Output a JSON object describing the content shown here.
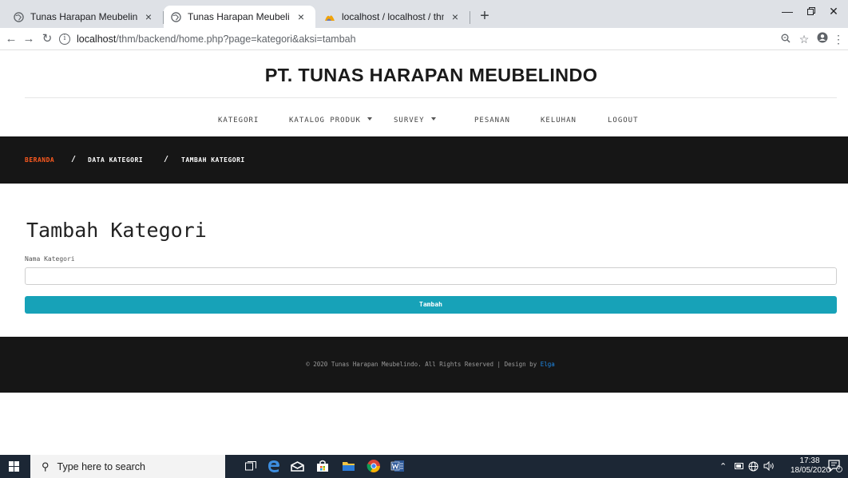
{
  "browser": {
    "tabs": [
      {
        "title": "Tunas Harapan Meubelindo",
        "active": false
      },
      {
        "title": "Tunas Harapan Meubelindo",
        "active": true
      },
      {
        "title": "localhost / localhost / thm / surv",
        "active": false
      }
    ],
    "tab_close_glyph": "×",
    "new_tab_glyph": "+",
    "url_host": "localhost",
    "url_path": "/thm/backend/home.php?page=kategori&aksi=tambah"
  },
  "site": {
    "title": "PT. TUNAS HARAPAN MEUBELINDO",
    "menu": [
      {
        "label": "KATEGORI",
        "dropdown": false
      },
      {
        "label": "KATALOG PRODUK",
        "dropdown": true
      },
      {
        "label": "SURVEY",
        "dropdown": true
      },
      {
        "label": "PESANAN",
        "dropdown": false
      },
      {
        "label": "KELUHAN",
        "dropdown": false
      },
      {
        "label": "LOGOUT",
        "dropdown": false
      }
    ],
    "breadcrumb": {
      "home": "BERANDA",
      "separator": "/",
      "level1": "DATA KATEGORI",
      "level2": "TAMBAH KATEGORI"
    },
    "colors": {
      "accent_breadcrumb": "#ff5a1f",
      "button": "#17a2b8",
      "dark_band": "#161616",
      "footer_link": "#1e88e5"
    }
  },
  "form": {
    "heading": "Tambah Kategori",
    "label": "Nama Kategori",
    "value": "",
    "submit_label": "Tambah"
  },
  "footer": {
    "text": "© 2020 Tunas Harapan Meubelindo. All Rights Reserved | Design by ",
    "author": "Elga"
  },
  "taskbar": {
    "search_placeholder": "Type here to search",
    "time": "17:38",
    "date": "18/05/2020",
    "notification_count": "6"
  }
}
